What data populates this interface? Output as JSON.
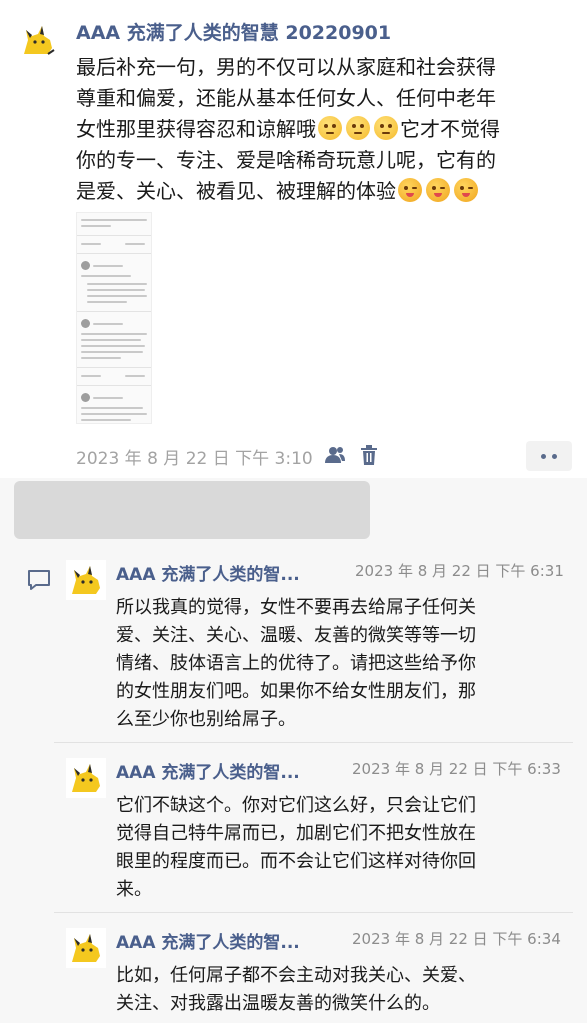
{
  "post": {
    "author": "AAA 充满了人类的智慧 20220901",
    "body_lines": [
      "最后补充一句，男的不仅可以从家庭和社会获得",
      "尊重和偏爱，还能从基本任何女人、任何中老年",
      "女性那里获得容忍和谅解哦",
      "它才不觉得",
      "你的专一、专注、爱是啥稀奇玩意儿呢，它有的",
      "是爱、关心、被看见、被理解的体验"
    ],
    "timestamp": "2023 年 8 月 22 日  下午 3:10",
    "icons": {
      "avatar": "cat-avatar-icon",
      "share": "share-friends-icon",
      "delete": "trash-icon",
      "more": "more-dots-icon",
      "emoji_think": "thinking-face-icon",
      "emoji_wink": "winking-tongue-face-icon"
    }
  },
  "comments": [
    {
      "author": "AAA 充满了人类的智...",
      "time": "2023 年 8 月 22 日  下午 6:31",
      "lines": [
        "所以我真的觉得，女性不要再去给屌子任何关",
        "爱、关注、关心、温暖、友善的微笑等等一切",
        "情绪、肢体语言上的优待了。请把这些给予你",
        "的女性朋友们吧。如果你不给女性朋友们，那",
        "么至少你也别给屌子。"
      ]
    },
    {
      "author": "AAA 充满了人类的智...",
      "time": "2023 年 8 月 22 日  下午 6:33",
      "lines": [
        "它们不缺这个。你对它们这么好，只会让它们",
        "觉得自己特牛屌而已，加剧它们不把女性放在",
        "眼里的程度而已。而不会让它们这样对待你回",
        "来。"
      ]
    },
    {
      "author": "AAA 充满了人类的智...",
      "time": "2023 年 8 月 22 日  下午 6:34",
      "lines": [
        "比如，任何屌子都不会主动对我关心、关爱、",
        "关注、对我露出温暖友善的微笑什么的。"
      ]
    }
  ],
  "colors": {
    "author": "#4a5f8c",
    "meta": "#a3a3a3",
    "comments_bg": "#f7f7f7",
    "blank_bar": "#d9d9d9"
  }
}
